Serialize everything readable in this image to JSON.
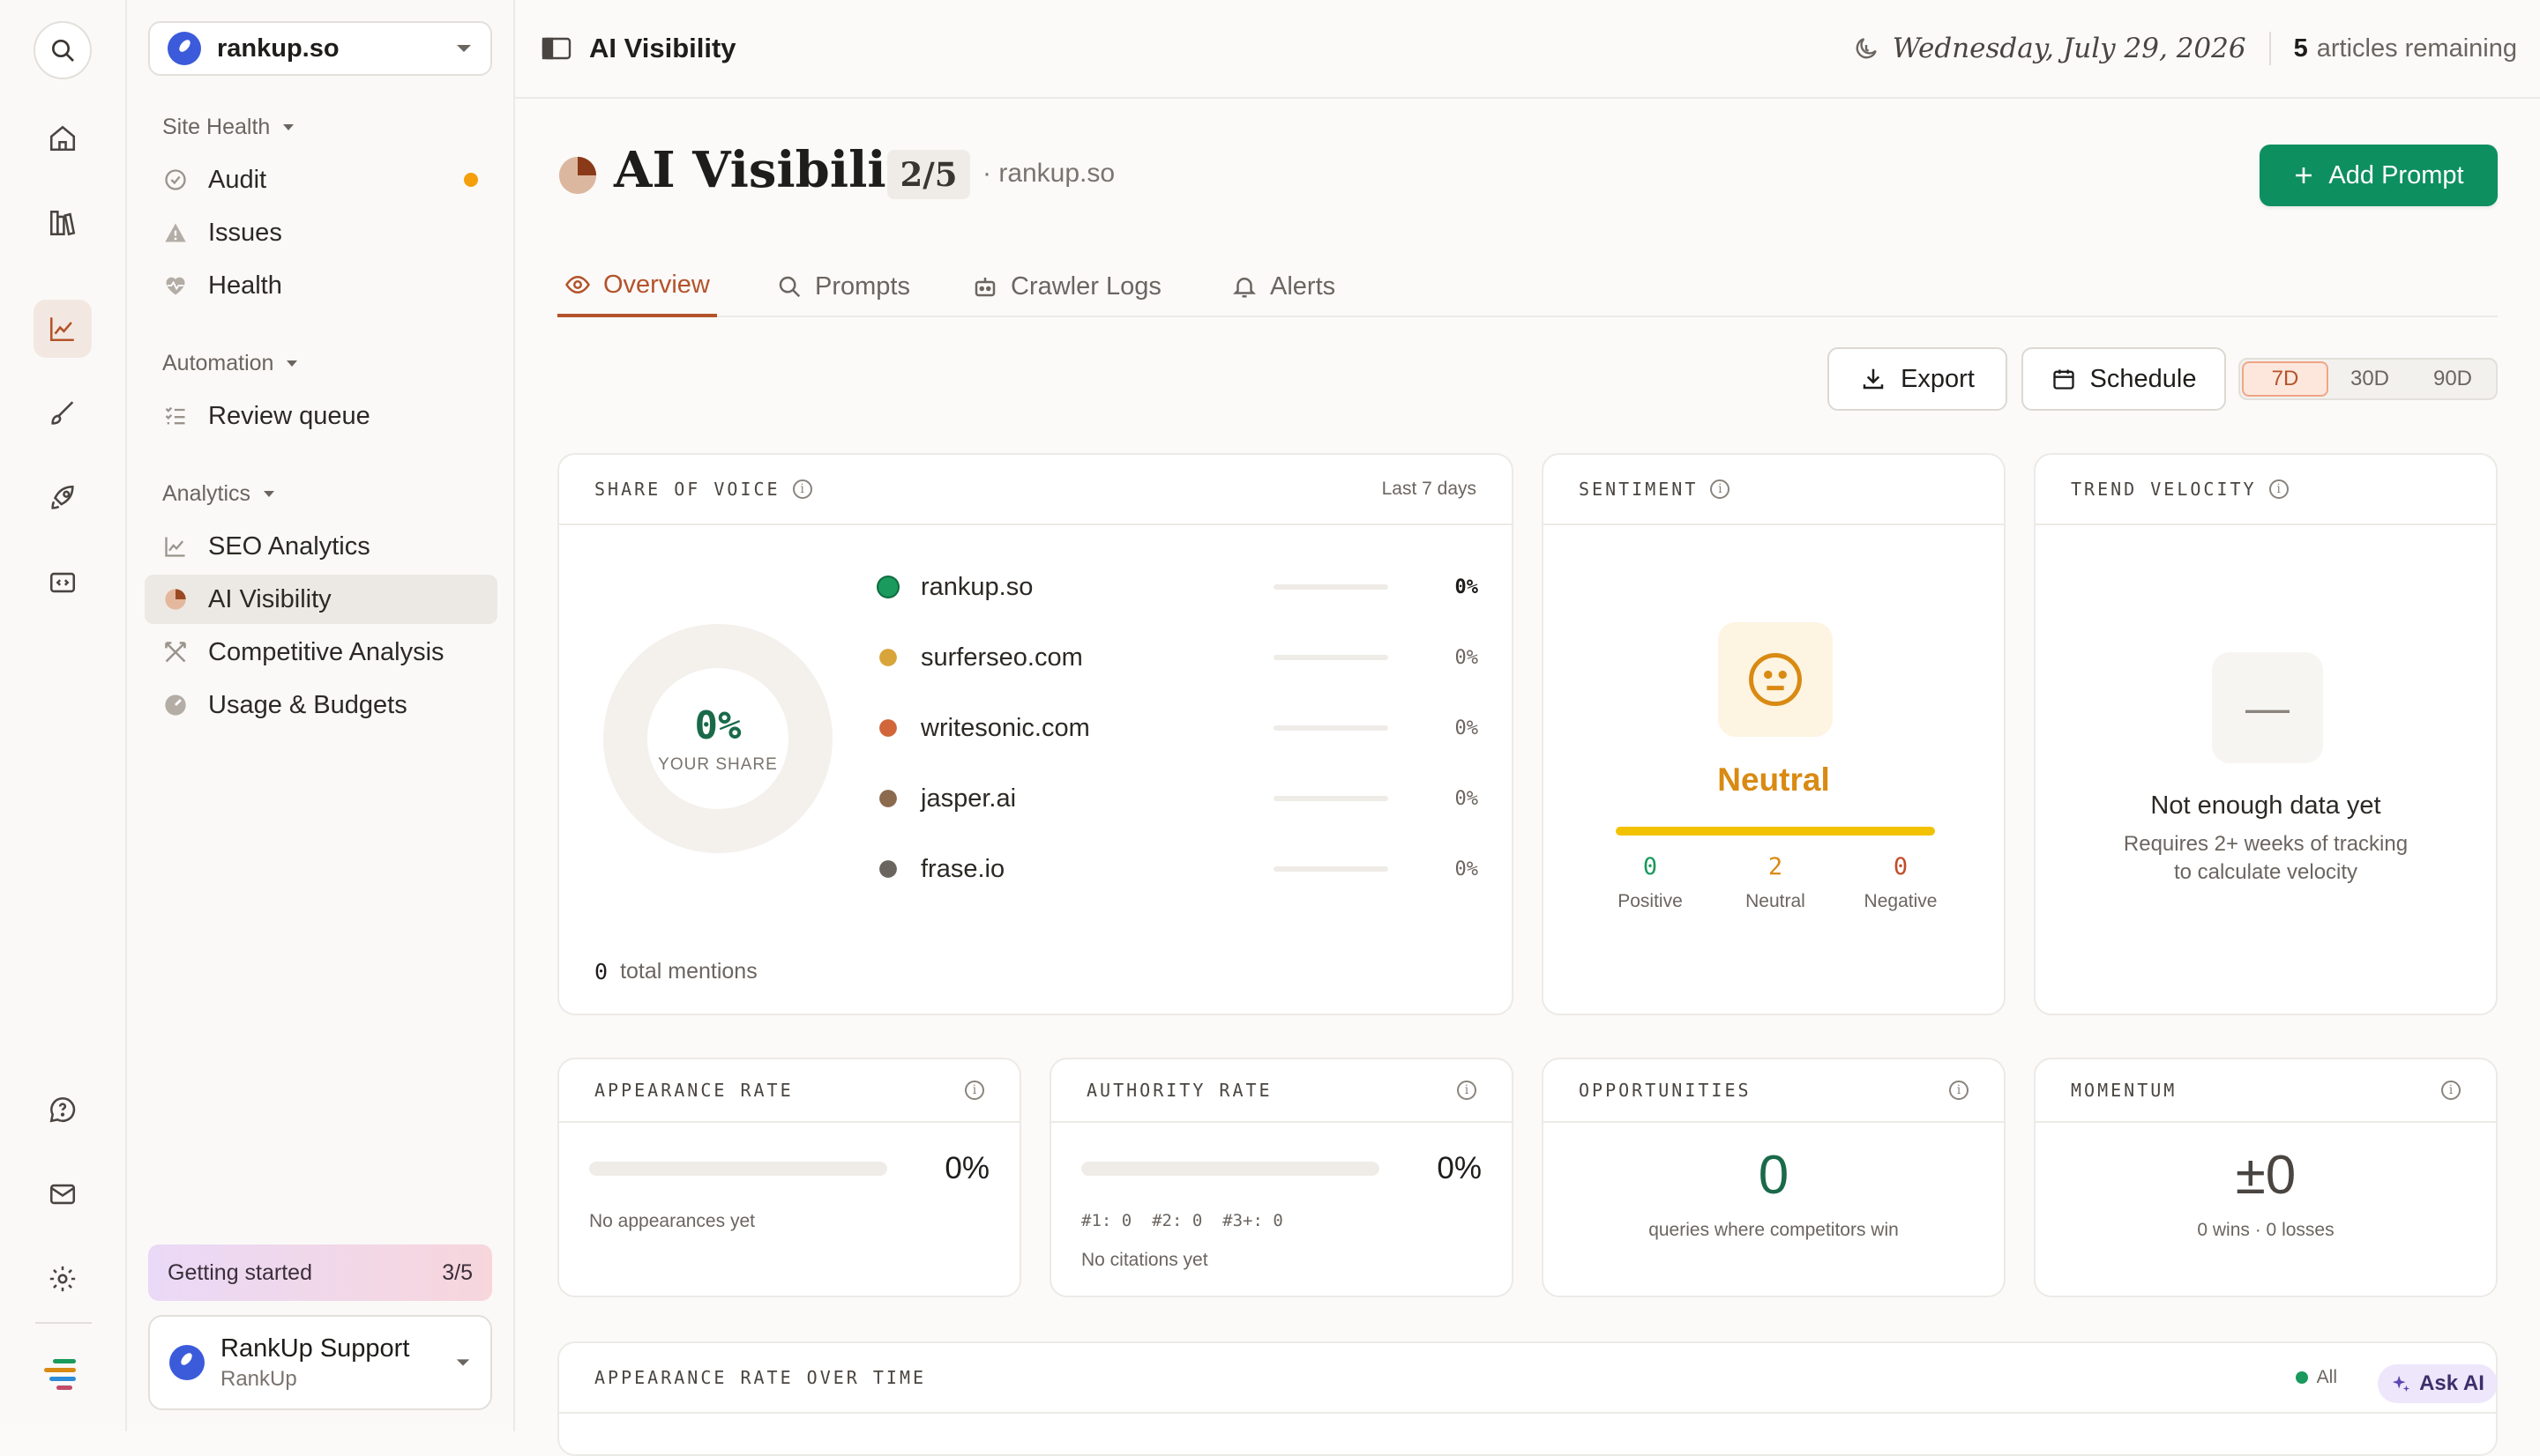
{
  "sidebar": {
    "site_name": "rankup.so",
    "groups": [
      {
        "label": "Site Health",
        "items": [
          "Audit",
          "Issues",
          "Health"
        ]
      },
      {
        "label": "Automation",
        "items": [
          "Review queue"
        ]
      },
      {
        "label": "Analytics",
        "items": [
          "SEO Analytics",
          "AI Visibility",
          "Competitive Analysis",
          "Usage & Budgets"
        ]
      }
    ],
    "getting_started": {
      "label": "Getting started",
      "progress": "3/5"
    },
    "support": {
      "name": "RankUp Support",
      "org": "RankUp"
    }
  },
  "topbar": {
    "title": "AI Visibility",
    "date": "Wednesday, July 29, 2026",
    "articles_count": "5",
    "articles_label": "articles remaining"
  },
  "page": {
    "title": "AI Visibility",
    "badge": "2/5",
    "site": "· rankup.so",
    "add_button": "Add Prompt",
    "tabs": [
      "Overview",
      "Prompts",
      "Crawler Logs",
      "Alerts"
    ],
    "export": "Export",
    "schedule": "Schedule",
    "ranges": [
      "7D",
      "30D",
      "90D"
    ],
    "active_range": "7D"
  },
  "share_of_voice": {
    "title": "SHARE OF VOICE",
    "period": "Last 7 days",
    "center_value": "0%",
    "center_label": "YOUR SHARE",
    "total_count": "0",
    "total_label": "total mentions",
    "competitors": [
      {
        "name": "rankup.so",
        "value": "0%",
        "color": "#1a9a5c"
      },
      {
        "name": "surferseo.com",
        "value": "0%",
        "color": "#d9a53a"
      },
      {
        "name": "writesonic.com",
        "value": "0%",
        "color": "#d0663a"
      },
      {
        "name": "jasper.ai",
        "value": "0%",
        "color": "#8b6a4e"
      },
      {
        "name": "frase.io",
        "value": "0%",
        "color": "#6b6560"
      }
    ]
  },
  "sentiment": {
    "title": "SENTIMENT",
    "state": "Neutral",
    "positive": "0",
    "positive_label": "Positive",
    "neutral": "2",
    "neutral_label": "Neutral",
    "negative": "0",
    "negative_label": "Negative"
  },
  "trend_velocity": {
    "title": "TREND VELOCITY",
    "glyph": "—",
    "message": "Not enough data yet",
    "sub1": "Requires 2+ weeks of tracking",
    "sub2": "to calculate velocity"
  },
  "appearance_rate": {
    "title": "APPEARANCE RATE",
    "value": "0%",
    "note": "No appearances yet",
    "fill": 0
  },
  "authority_rate": {
    "title": "AUTHORITY RATE",
    "value": "0%",
    "ranks": "#1: 0  #2: 0  #3+: 0",
    "note": "No citations yet",
    "fill": 0
  },
  "opportunities": {
    "title": "OPPORTUNITIES",
    "value": "0",
    "note": "queries where competitors win"
  },
  "momentum": {
    "title": "MOMENTUM",
    "value": "±0",
    "note": "0 wins · 0 losses"
  },
  "over_time": {
    "title": "APPEARANCE RATE OVER TIME",
    "legend": "All"
  },
  "ask_ai": "Ask AI",
  "colors": {
    "accent": "#b4532a",
    "brand_green": "#0e8f5f",
    "neutral_amber": "#d98a12"
  }
}
